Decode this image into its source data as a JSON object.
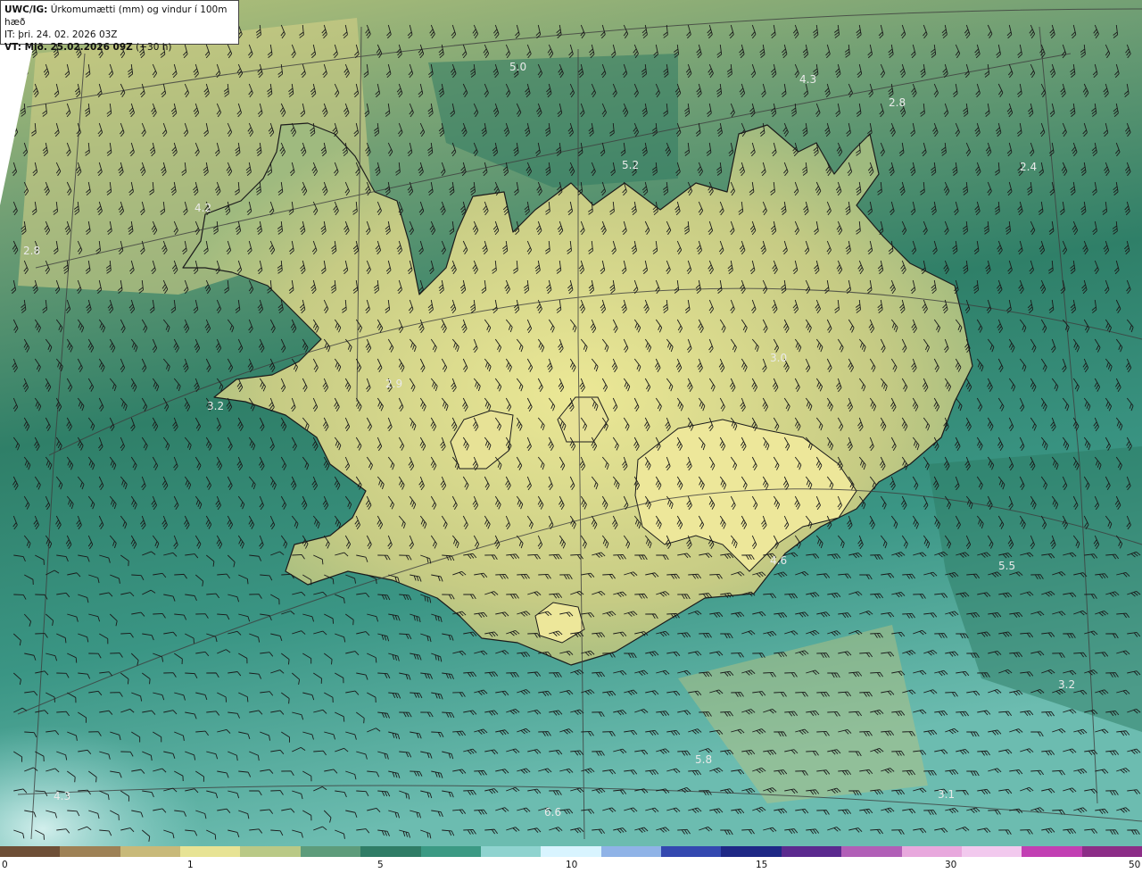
{
  "header": {
    "product": "UWC/IG:",
    "title": "Úrkomumætti (mm) og vindur í 100m hæð",
    "initial_time": "IT: þri. 24. 02. 2026 03Z",
    "valid_prefix": "VT: Mið. 25.02.2026 09Z",
    "valid_suffix": "(+30 h)"
  },
  "map": {
    "ocean_color": "#2f8a6f",
    "land_color": "#d9d684",
    "value_labels": [
      "5.0",
      "4.3",
      "2.8",
      "5.2",
      "2.4",
      "4.2",
      "2.8",
      "3.0",
      "2.9",
      "3.2",
      "5.5",
      "4.6",
      "3.2",
      "5.8",
      "3.1",
      "6.6",
      "4.3"
    ]
  },
  "colorbar": {
    "ticks": [
      "0",
      "1",
      "5",
      "10",
      "15",
      "30",
      "50"
    ],
    "colors": [
      "#6e4f36",
      "#9e8155",
      "#c8b979",
      "#e7e394",
      "#b9c986",
      "#5d9c7b",
      "#2f7d66",
      "#3b9a84",
      "#8fd3cf",
      "#d8f4ff",
      "#8fb3e7",
      "#3348b0",
      "#1e2886",
      "#5b2a8f",
      "#b15fb7",
      "#e8a8dd",
      "#f2c9ee",
      "#c23fb3",
      "#8c2d87"
    ]
  }
}
